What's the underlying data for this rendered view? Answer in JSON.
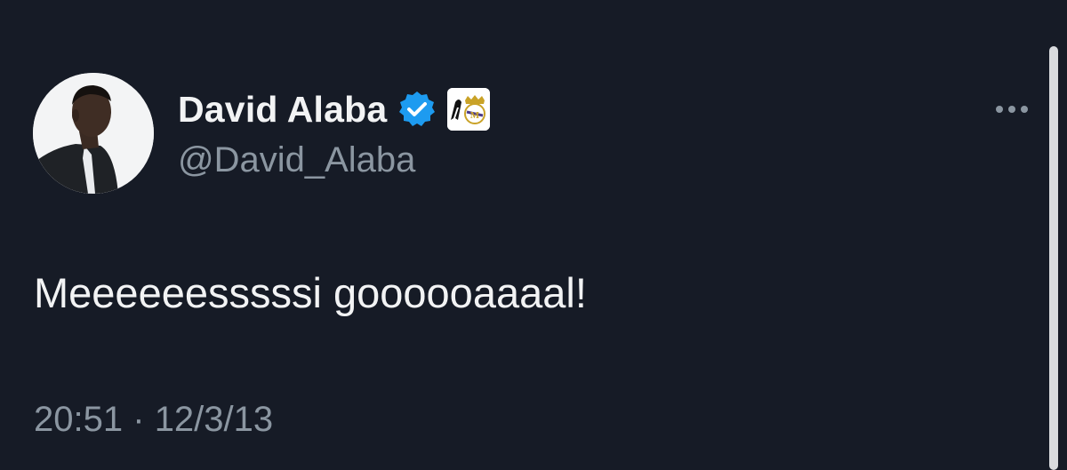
{
  "user": {
    "display_name": "David Alaba",
    "handle": "@David_Alaba",
    "verified": true
  },
  "tweet": {
    "text": "Meeeeeesssssi goooooaaaal!",
    "time": "20:51",
    "separator": "·",
    "date": "12/3/13"
  },
  "icons": {
    "verified": "verified-badge-icon",
    "club": "club-crest-icon",
    "more": "more-options-icon"
  },
  "colors": {
    "background": "#161b26",
    "primary_text": "#f2f3f4",
    "secondary_text": "#8b96a1",
    "verified_blue": "#1d9bf0"
  }
}
